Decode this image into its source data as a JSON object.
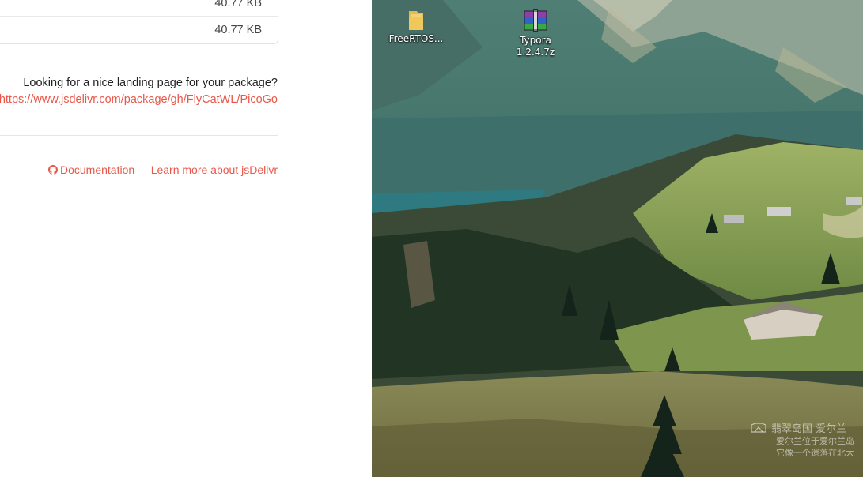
{
  "browser": {
    "file_rows": [
      {
        "size": "40.77 KB"
      },
      {
        "size": "40.77 KB"
      }
    ],
    "landing_question": "Looking for a nice landing page for your package?",
    "landing_link": "https://www.jsdelivr.com/package/gh/FlyCatWL/PicoGo",
    "footer": {
      "documentation": "Documentation",
      "learn_more": "Learn more about jsDelivr"
    },
    "link_color": "#e8584a"
  },
  "desktop": {
    "icons": [
      {
        "label": "FreeRTOS...",
        "icon": "folder-icon"
      },
      {
        "label_line1": "Typora",
        "label_line2": "1.2.4.7z",
        "icon": "winrar-archive-icon"
      }
    ],
    "watermark": {
      "title": "翡翠岛国 爱尔兰",
      "line1": "爱尔兰位于爱尔兰岛",
      "line2": "它像一个遗落在北大"
    }
  }
}
